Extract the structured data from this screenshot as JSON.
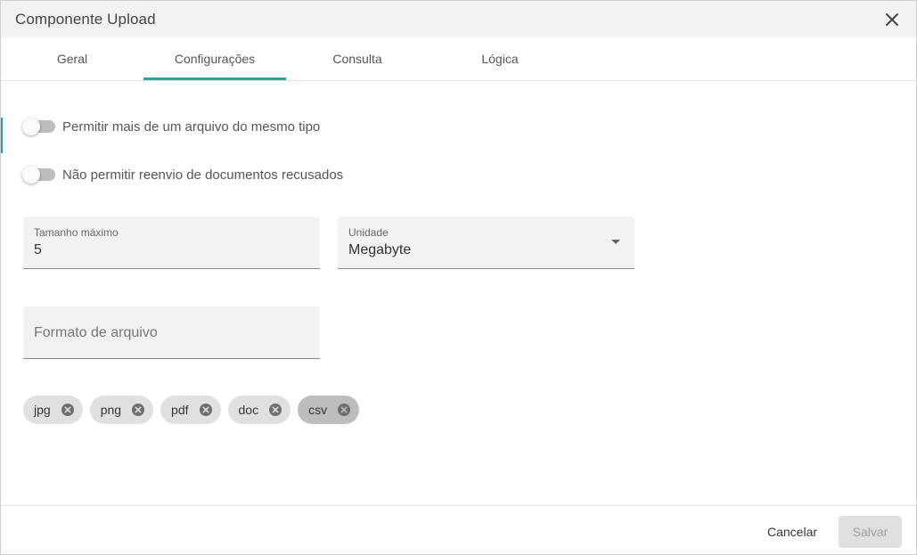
{
  "dialog": {
    "title": "Componente Upload",
    "close_icon": "close-icon"
  },
  "tabs": [
    {
      "label": "Geral",
      "active": false
    },
    {
      "label": "Configurações",
      "active": true
    },
    {
      "label": "Consulta",
      "active": false
    },
    {
      "label": "Lógica",
      "active": false
    }
  ],
  "toggles": [
    {
      "label": "Permitir mais de um arquivo do mesmo tipo",
      "checked": false
    },
    {
      "label": "Não permitir reenvio de documentos recusados",
      "checked": false
    }
  ],
  "fields": {
    "max_size": {
      "label": "Tamanho máximo",
      "value": "5"
    },
    "unit": {
      "label": "Unidade",
      "value": "Megabyte",
      "icon": "dropdown-arrow-icon"
    },
    "file_format": {
      "placeholder": "Formato de arquivo"
    }
  },
  "chips": [
    {
      "label": "jpg",
      "selected": false
    },
    {
      "label": "png",
      "selected": false
    },
    {
      "label": "pdf",
      "selected": false
    },
    {
      "label": "doc",
      "selected": false
    },
    {
      "label": "csv",
      "selected": true
    }
  ],
  "footer": {
    "cancel_label": "Cancelar",
    "save_label": "Salvar",
    "save_disabled": true
  },
  "colors": {
    "accent": "#26a69a",
    "header_bg": "#f2f2f2",
    "field_bg": "#f2f2f2",
    "chip_bg": "#e0e0e0",
    "chip_selected_bg": "#bdbdbd"
  }
}
